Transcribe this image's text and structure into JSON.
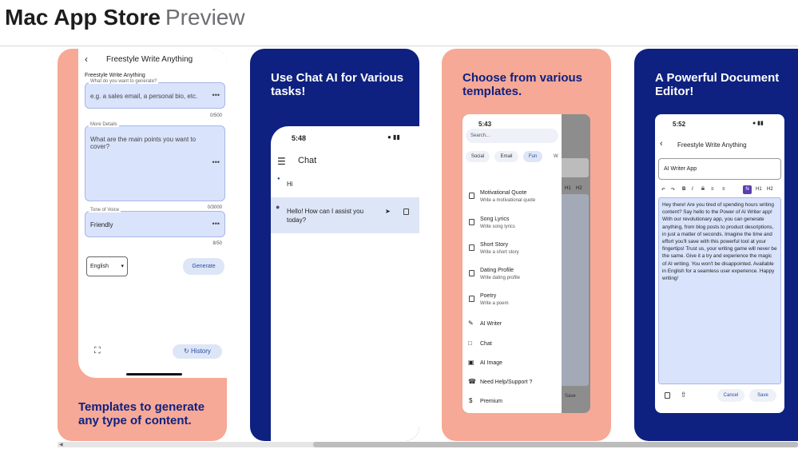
{
  "header": {
    "title_bold": "Mac App Store",
    "title_light": "Preview"
  },
  "colors": {
    "salmon": "#f6a996",
    "navy": "#0e2180",
    "field": "#d9e3fb"
  },
  "shot1": {
    "screen_title": "Freestyle Write Anything",
    "section": "Freestyle Write Anything",
    "field1_label": "What do you want to generate?",
    "field1_placeholder": "e.g. a sales email, a personal bio, etc.",
    "field1_count": "0/500",
    "field2_label": "More Details",
    "field2_placeholder": "What are the main points you want to cover?",
    "field2_count": "0/3000",
    "field3_label": "Tone of Voice",
    "field3_value": "Friendly",
    "field3_count": "8/50",
    "language": "English",
    "generate": "Generate",
    "history": "History",
    "caption": "Templates to generate any type of content."
  },
  "shot2": {
    "caption": "Use Chat AI for Various tasks!",
    "time": "5:48",
    "title": "Chat",
    "user_msg": "Hi",
    "ai_msg": "Hello! How can I assist you today?"
  },
  "shot3": {
    "caption": "Choose from various templates.",
    "time": "5:43",
    "search_placeholder": "Search...",
    "chips": [
      "Social",
      "Email",
      "Fun",
      "W"
    ],
    "templates": [
      {
        "title": "Motivational Quote",
        "sub": "Write a motivational quote"
      },
      {
        "title": "Song Lyrics",
        "sub": "Write song lyrics"
      },
      {
        "title": "Short Story",
        "sub": "Write a short story"
      },
      {
        "title": "Dating Profile",
        "sub": "Write dating profile"
      },
      {
        "title": "Poetry",
        "sub": "Write a poem"
      }
    ],
    "menu": [
      "AI Writer",
      "Chat",
      "AI Image",
      "Need Help/Support ?",
      "Premium"
    ],
    "bg_h1": "H1",
    "bg_h2": "H2",
    "bg_save": "Save"
  },
  "shot4": {
    "caption": "A Powerful Document Editor!",
    "time": "5:52",
    "title": "Freestyle Write Anything",
    "doc_title": "AI Writer App",
    "toolbar": [
      "↶",
      "↷",
      "B",
      "I",
      "S",
      "≡",
      "≡",
      "N",
      "H1",
      "H2"
    ],
    "body": "Hey there! Are you tired of spending hours writing content? Say hello to the Power of AI Writer app! With our revolutionary app, you can generate anything, from blog posts to product descriptions, in just a matter of seconds. Imagine the time and effort you'll save with this powerful tool at your fingertips! Trust us, your writing game will never be the same. Give it a try and experience the magic of AI writing. You won't be disappointed. Available in English for a seamless user experience. Happy writing!",
    "cancel": "Cancel",
    "save": "Save"
  }
}
